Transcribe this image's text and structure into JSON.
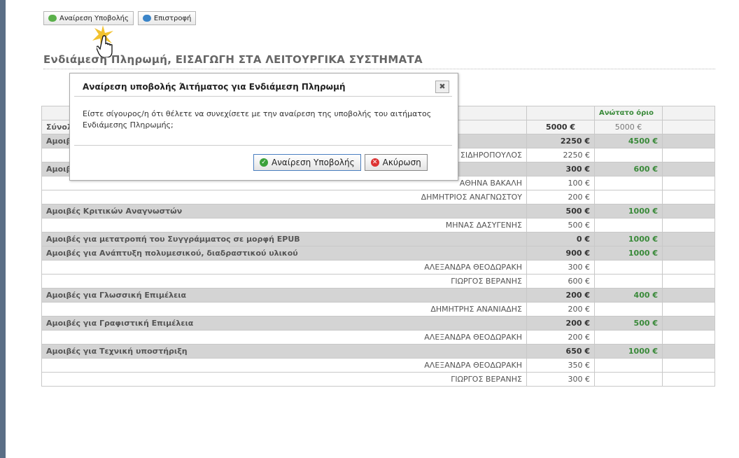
{
  "toolbar": {
    "withdraw_label": "Αναίρεση Υποβολής",
    "back_label": "Επιστροφή"
  },
  "page": {
    "title": "Ενδιάμεση Πληρωμή, ΕΙΣΑΓΩΓΗ ΣΤΑ ΛΕΙΤΟΥΡΓΙΚΑ ΣΥΣΤΗΜΑΤΑ"
  },
  "table": {
    "header_limit": "Ανώτατο όριο",
    "total": {
      "label": "Σύνολο",
      "amount": "5000 €",
      "limit": "5000 €"
    },
    "rows": [
      {
        "type": "cat",
        "label": "Αμοιβές Συγγραφέων",
        "amount": "2250 €",
        "limit": "4500 €"
      },
      {
        "type": "person",
        "label": "ΑΝΤΩΝΙΟΣ ΣΙΔΗΡΟΠΟΥΛΟΣ",
        "amount": "2250 €"
      },
      {
        "type": "cat",
        "label": "Αμοιβές Συν-Συγγραφέων",
        "amount": "300 €",
        "limit": "600 €"
      },
      {
        "type": "person",
        "label": "ΑΘΗΝΑ ΒΑΚΑΛΗ",
        "amount": "100 €"
      },
      {
        "type": "person",
        "label": "ΔΗΜΗΤΡΙΟΣ ΑΝΑΓΝΩΣΤΟΥ",
        "amount": "200 €"
      },
      {
        "type": "cat",
        "label": "Αμοιβές Κριτικών Αναγνωστών",
        "amount": "500 €",
        "limit": "1000 €"
      },
      {
        "type": "person",
        "label": "ΜΗΝΑΣ ΔΑΣΥΓΕΝΗΣ",
        "amount": "500 €"
      },
      {
        "type": "cat",
        "label": "Αμοιβές για μετατροπή του Συγγράμματος σε μορφή EPUB",
        "amount": "0 €",
        "limit": "1000 €"
      },
      {
        "type": "cat",
        "label": "Αμοιβές για Ανάπτυξη πολυμεσικού, διαδραστικού υλικού",
        "amount": "900 €",
        "limit": "1000 €"
      },
      {
        "type": "person",
        "label": "ΑΛΕΞΑΝΔΡΑ ΘΕΟΔΩΡΑΚΗ",
        "amount": "300 €"
      },
      {
        "type": "person",
        "label": "ΓΙΩΡΓΟΣ ΒΕΡΑΝΗΣ",
        "amount": "600 €"
      },
      {
        "type": "cat",
        "label": "Αμοιβές για Γλωσσική Επιμέλεια",
        "amount": "200 €",
        "limit": "400 €"
      },
      {
        "type": "person",
        "label": "ΔΗΜΗΤΡΗΣ ΑΝΑΝΙΑΔΗΣ",
        "amount": "200 €"
      },
      {
        "type": "cat",
        "label": "Αμοιβές για Γραφιστική Επιμέλεια",
        "amount": "200 €",
        "limit": "500 €"
      },
      {
        "type": "person",
        "label": "ΑΛΕΞΑΝΔΡΑ ΘΕΟΔΩΡΑΚΗ",
        "amount": "200 €"
      },
      {
        "type": "cat",
        "label": "Αμοιβές για Τεχνική υποστήριξη",
        "amount": "650 €",
        "limit": "1000 €"
      },
      {
        "type": "person",
        "label": "ΑΛΕΞΑΝΔΡΑ ΘΕΟΔΩΡΑΚΗ",
        "amount": "350 €"
      },
      {
        "type": "person",
        "label": "ΓΙΩΡΓΟΣ ΒΕΡΑΝΗΣ",
        "amount": "300 €"
      }
    ]
  },
  "dialog": {
    "title": "Αναίρεση υποβολής Άιτήματος για Ενδιάμεση Πληρωμή",
    "close": "✖",
    "message": "Είστε σίγουρος/η ότι θέλετε να συνεχίσετε με την αναίρεση της υποβολής του αιτήματος Ενδιάμεσης Πληρωμής;",
    "confirm_label": "Αναίρεση Υποβολής",
    "cancel_label": "Ακύρωση"
  }
}
